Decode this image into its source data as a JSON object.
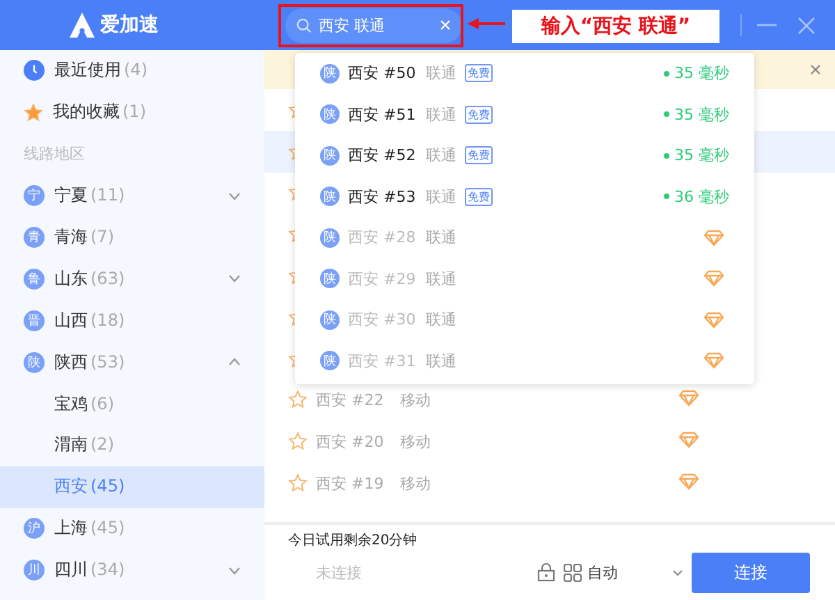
{
  "app": {
    "name": "爱加速"
  },
  "search": {
    "value": "西安 联通"
  },
  "annotation": {
    "text": "输入“西安  联通”"
  },
  "sidebar": {
    "items": [
      {
        "kind": "recent",
        "label": "最近使用",
        "count": "(4)",
        "selected": false
      },
      {
        "kind": "favorite",
        "label": "我的收藏",
        "count": "(1)",
        "selected": false
      },
      {
        "kind": "section",
        "label": "线路地区"
      },
      {
        "kind": "province",
        "badge": "宁",
        "label": "宁夏",
        "count": "(11)",
        "expanded": false,
        "selected": false
      },
      {
        "kind": "province",
        "badge": "青",
        "label": "青海",
        "count": "(7)",
        "selected": false
      },
      {
        "kind": "province",
        "badge": "鲁",
        "label": "山东",
        "count": "(63)",
        "expanded": false,
        "selected": false
      },
      {
        "kind": "province",
        "badge": "晋",
        "label": "山西",
        "count": "(18)",
        "selected": false
      },
      {
        "kind": "province",
        "badge": "陕",
        "label": "陕西",
        "count": "(53)",
        "expanded": true,
        "selected": false
      },
      {
        "kind": "city",
        "label": "宝鸡",
        "count": "(6)",
        "selected": false
      },
      {
        "kind": "city",
        "label": "渭南",
        "count": "(2)",
        "selected": false
      },
      {
        "kind": "city",
        "label": "西安",
        "count": "(45)",
        "selected": true
      },
      {
        "kind": "province",
        "badge": "沪",
        "label": "上海",
        "count": "(45)",
        "selected": false
      },
      {
        "kind": "province",
        "badge": "川",
        "label": "四川",
        "count": "(34)",
        "expanded": false,
        "selected": false
      }
    ]
  },
  "lines": [
    {
      "selected": false
    },
    {
      "selected": true
    },
    {
      "selected": false
    },
    {
      "selected": false
    },
    {
      "selected": false
    },
    {
      "selected": false
    },
    {
      "selected": false
    },
    {
      "name": "西安 #22",
      "carrier": "移动",
      "selected": false
    },
    {
      "name": "西安 #20",
      "carrier": "移动",
      "selected": false
    },
    {
      "name": "西安 #19",
      "carrier": "移动",
      "selected": false
    }
  ],
  "suggestions": [
    {
      "kind": "free",
      "badge": "陕",
      "name": "西安 #50",
      "carrier": "联通",
      "tag": "免费",
      "latency": "35 毫秒"
    },
    {
      "kind": "free",
      "badge": "陕",
      "name": "西安 #51",
      "carrier": "联通",
      "tag": "免费",
      "latency": "35 毫秒"
    },
    {
      "kind": "free",
      "badge": "陕",
      "name": "西安 #52",
      "carrier": "联通",
      "tag": "免费",
      "latency": "35 毫秒"
    },
    {
      "kind": "free",
      "badge": "陕",
      "name": "西安 #53",
      "carrier": "联通",
      "tag": "免费",
      "latency": "36 毫秒"
    },
    {
      "kind": "vip",
      "badge": "陕",
      "name": "西安 #28",
      "carrier": "联通"
    },
    {
      "kind": "vip",
      "badge": "陕",
      "name": "西安 #29",
      "carrier": "联通"
    },
    {
      "kind": "vip",
      "badge": "陕",
      "name": "西安 #30",
      "carrier": "联通"
    },
    {
      "kind": "vip",
      "badge": "陕",
      "name": "西安 #31",
      "carrier": "联通"
    }
  ],
  "footer": {
    "trial": "今日试用剩余20分钟",
    "status": "未连接",
    "mode": "自动",
    "connect": "连接"
  }
}
